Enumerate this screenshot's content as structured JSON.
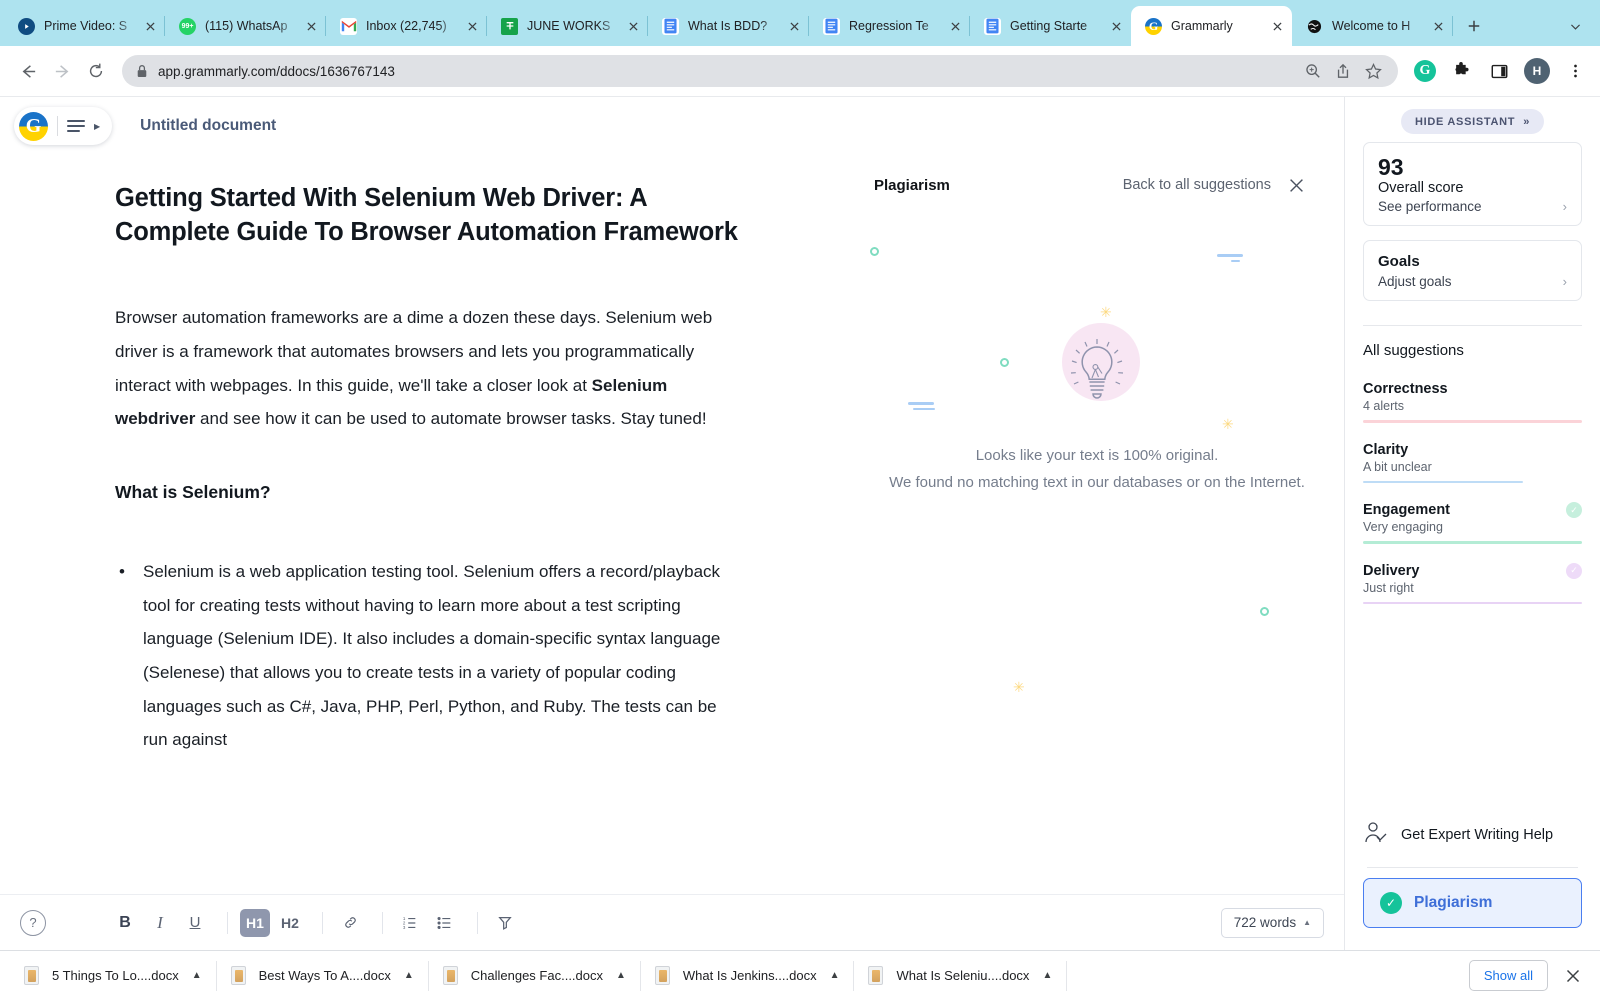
{
  "browser": {
    "tabs": [
      {
        "title": "Prime Video: S",
        "icon": "prime-video-icon",
        "active": false
      },
      {
        "title": "(115) WhatsAp",
        "icon": "whatsapp-icon",
        "active": false
      },
      {
        "title": "Inbox (22,745)",
        "icon": "gmail-icon",
        "active": false
      },
      {
        "title": "JUNE WORKS",
        "icon": "excel-icon",
        "active": false
      },
      {
        "title": "What Is BDD?",
        "icon": "google-docs-icon",
        "active": false
      },
      {
        "title": "Regression Te",
        "icon": "google-docs-icon",
        "active": false
      },
      {
        "title": "Getting Starte",
        "icon": "google-docs-icon",
        "active": false
      },
      {
        "title": "Grammarly",
        "icon": "grammarly-icon",
        "active": true
      },
      {
        "title": "Welcome to H",
        "icon": "globe-icon",
        "active": false
      }
    ],
    "new_tab_label": "+",
    "url": "app.grammarly.com/ddocs/1636767143",
    "profile_initial": "H",
    "grammarly_extension_glyph": "G"
  },
  "editor": {
    "doc_title": "Untitled document",
    "heading": "Getting Started With Selenium Web Driver: A Complete Guide To Browser Automation Framework",
    "paragraph_pre": "Browser automation frameworks are a dime a dozen these days. Selenium web driver is a framework that automates browsers and lets you programmatically interact with webpages. In this guide, we'll take a closer look at ",
    "paragraph_bold": "Selenium webdriver",
    "paragraph_post": " and see how it can be used to automate browser tasks. Stay tuned!",
    "subheading": "What is Selenium?",
    "bullet": "Selenium is a web application testing tool. Selenium offers a record/playback tool for creating tests without having to learn more about a test scripting language (Selenium IDE). It also includes a domain-specific syntax language (Selenese) that allows you to create tests in a variety of popular coding languages such as C#, Java, PHP, Perl, Python, and Ruby. The tests can be run against"
  },
  "plagiarism": {
    "title": "Plagiarism",
    "back_link": "Back to all suggestions",
    "line1": "Looks like your text is 100% original.",
    "line2": "We found no matching text in our databases or on the Internet."
  },
  "toolbar": {
    "help": "?",
    "bold": "B",
    "italic": "I",
    "underline": "U",
    "h1": "H1",
    "h2": "H2",
    "link": "link-icon",
    "ordered_list": "numbered-list-icon",
    "bullet_list": "bullet-list-icon",
    "clear_format": "clear-formatting-icon",
    "word_count": "722 words"
  },
  "assistant": {
    "hide_label": "HIDE ASSISTANT",
    "score": "93",
    "score_label": "Overall score",
    "score_link": "See performance",
    "goals_title": "Goals",
    "goals_link": "Adjust goals",
    "all_suggestions": "All suggestions",
    "metrics": [
      {
        "name": "Correctness",
        "value": "4 alerts",
        "color": "#fbd3d8",
        "check": false,
        "check_bg": ""
      },
      {
        "name": "Clarity",
        "value": "A bit unclear",
        "color": "#bedcf6",
        "check": false,
        "check_bg": ""
      },
      {
        "name": "Engagement",
        "value": "Very engaging",
        "color": "#b4ecd5",
        "check": true,
        "check_bg": "#c6efdd"
      },
      {
        "name": "Delivery",
        "value": "Just right",
        "color": "#e8d3f5",
        "check": true,
        "check_bg": "#eedbf8"
      }
    ],
    "expert_label": "Get Expert Writing Help",
    "plagiarism_label": "Plagiarism"
  },
  "downloads": {
    "files": [
      "5 Things To Lo....docx",
      "Best Ways To A....docx",
      "Challenges Fac....docx",
      "What Is Jenkins....docx",
      "What Is Seleniu....docx"
    ],
    "show_all": "Show all"
  }
}
